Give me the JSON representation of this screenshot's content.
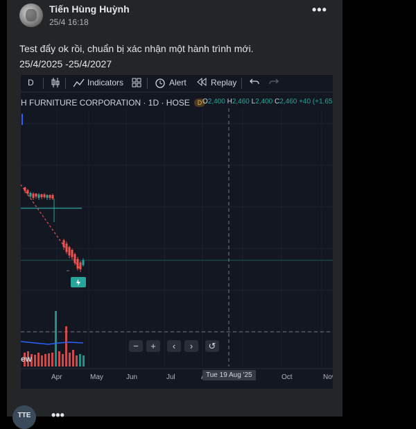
{
  "post": {
    "author": "Tiến Hùng Huỳnh",
    "time": "25/4 16:18",
    "text": "Test đẩy ok rồi, chuẩn bị xác nhận một hành trình mới.\n25/4/2025 -25/4/2027"
  },
  "chart_screenshot": {
    "toolbar": {
      "interval": "D",
      "indicators_label": "Indicators",
      "alert_label": "Alert",
      "replay_label": "Replay"
    },
    "symbol_title": "H FURNITURE CORPORATION · 1D · HOSE",
    "badge": "D",
    "ohlc": {
      "o_label": "O",
      "o": "2,400",
      "h_label": "H",
      "h": "2,460",
      "l_label": "L",
      "l": "2,400",
      "c_label": "C",
      "c": "2,460",
      "change": "+40 (+1.65"
    },
    "nav_buttons": [
      "−",
      "+",
      "‹",
      "›",
      "↺"
    ],
    "x_axis_labels": [
      "Apr",
      "May",
      "Jun",
      "Jul",
      "A",
      "Oct",
      "Nov"
    ],
    "crosshair_label": "Tue 19 Aug '25",
    "watermark_fragment": "ew",
    "colors": {
      "up": "#26a69a",
      "down": "#ef5350",
      "background": "#131722"
    }
  },
  "second_comment": {
    "avatar_text": "TTE"
  }
}
